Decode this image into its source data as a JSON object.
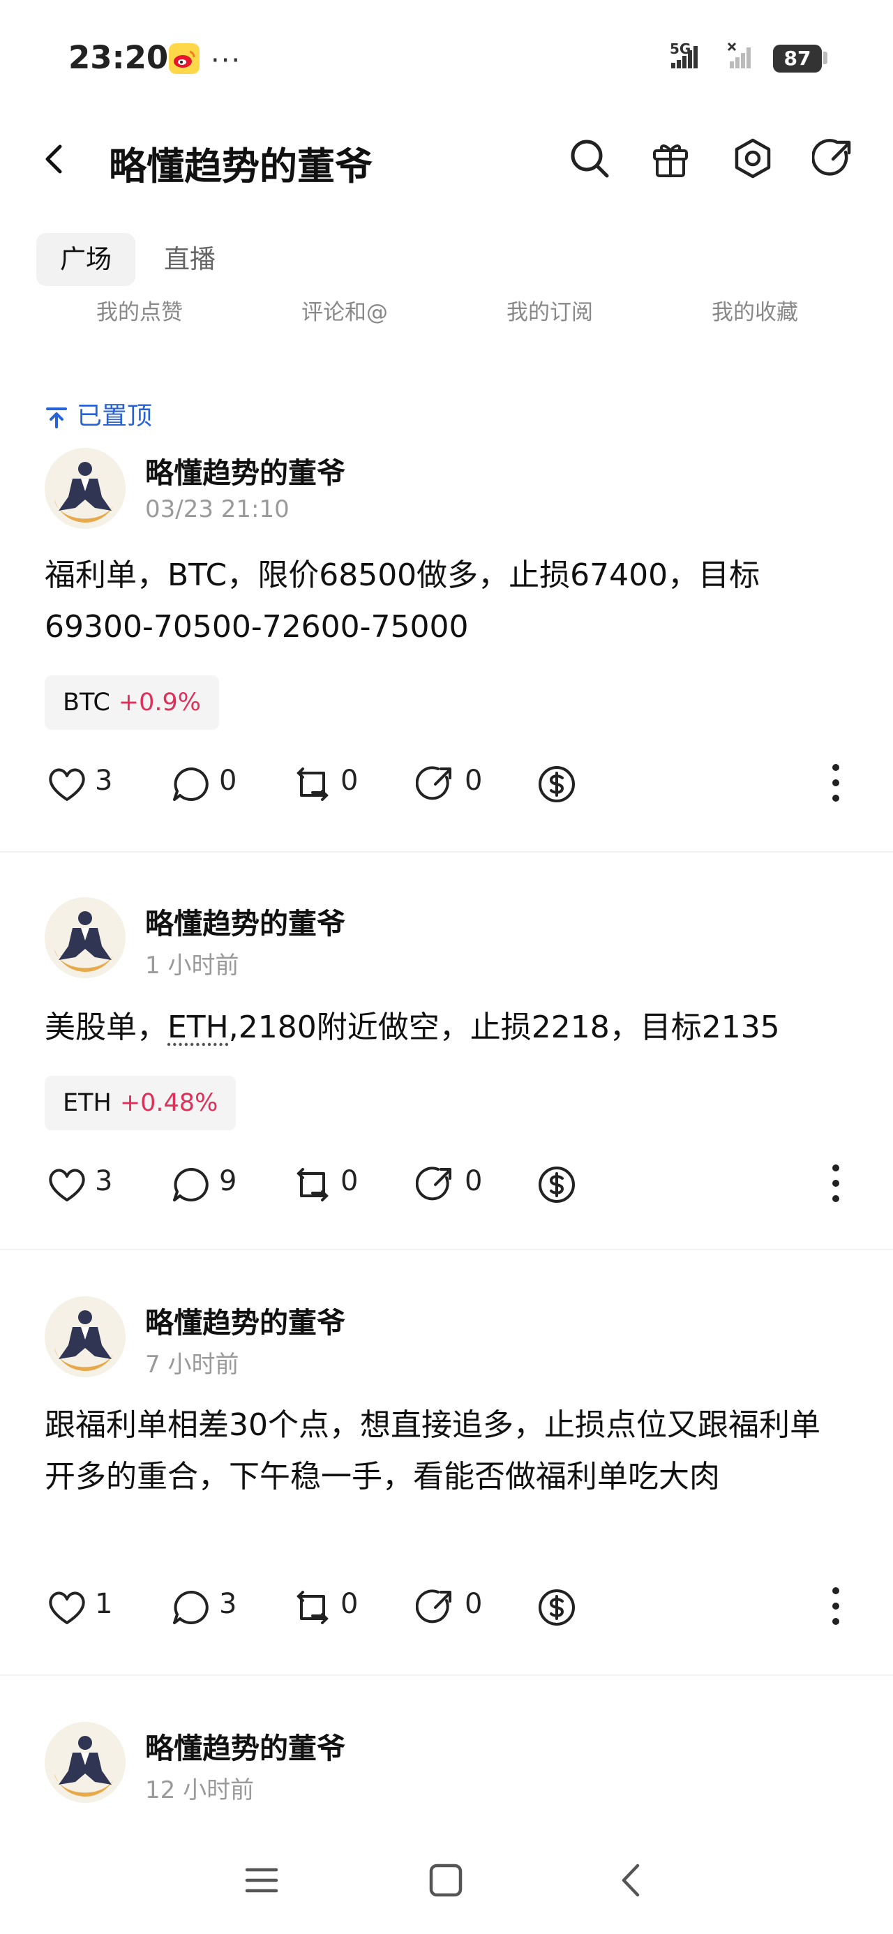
{
  "status_bar": {
    "time": "23:20",
    "more": "···",
    "network": "5G",
    "battery": "87"
  },
  "header": {
    "title": "略懂趋势的董爷"
  },
  "tabs": [
    {
      "label": "广场",
      "active": true
    },
    {
      "label": "直播",
      "active": false
    }
  ],
  "subnav": [
    "我的点赞",
    "评论和@",
    "我的订阅",
    "我的收藏"
  ],
  "pinned_label": "已置顶",
  "posts": [
    {
      "author": "略懂趋势的董爷",
      "time": "03/23 21:10",
      "content": "福利单，BTC，限价68500做多，止损67400，目标69300-70500-72600-75000",
      "tag": {
        "symbol": "BTC",
        "change": "+0.9%"
      },
      "likes": "3",
      "comments": "0",
      "reposts": "0",
      "shares": "0"
    },
    {
      "author": "略懂趋势的董爷",
      "time": "1 小时前",
      "content_prefix": "美股单，",
      "content_link": "ETH",
      "content_suffix": ",2180附近做空，止损2218，目标2135",
      "tag": {
        "symbol": "ETH",
        "change": "+0.48%"
      },
      "likes": "3",
      "comments": "9",
      "reposts": "0",
      "shares": "0"
    },
    {
      "author": "略懂趋势的董爷",
      "time": "7 小时前",
      "content": "跟福利单相差30个点，想直接追多，止损点位又跟福利单开多的重合，下午稳一手，看能否做福利单吃大肉",
      "likes": "1",
      "comments": "3",
      "reposts": "0",
      "shares": "0"
    },
    {
      "author": "略懂趋势的董爷",
      "time": "12 小时前"
    }
  ],
  "colors": {
    "accent_blue": "#2762d6",
    "positive_change": "#e0305a",
    "tag_bg": "#f4f4f4"
  }
}
